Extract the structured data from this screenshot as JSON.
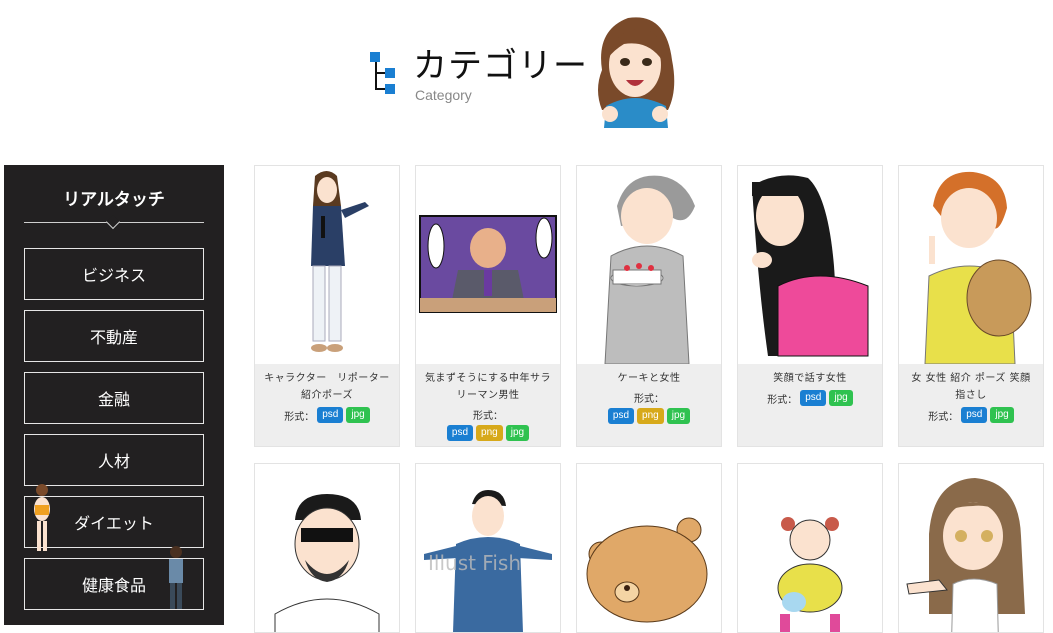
{
  "header": {
    "title": "カテゴリー",
    "subtitle": "Category"
  },
  "sidebar": {
    "heading": "リアルタッチ",
    "items": [
      {
        "label": "ビジネス"
      },
      {
        "label": "不動産"
      },
      {
        "label": "金融"
      },
      {
        "label": "人材"
      },
      {
        "label": "ダイエット"
      },
      {
        "label": "健康食品"
      }
    ]
  },
  "format_label": "形式：",
  "cards": [
    {
      "title": "キャラクター　リポーター　紹介ポーズ",
      "formats": [
        "psd",
        "jpg"
      ]
    },
    {
      "title": "気まずそうにする中年サラリーマン男性",
      "formats": [
        "psd",
        "png",
        "jpg"
      ]
    },
    {
      "title": "ケーキと女性",
      "formats": [
        "psd",
        "png",
        "jpg"
      ]
    },
    {
      "title": "笑顔で話す女性",
      "formats": [
        "psd",
        "jpg"
      ]
    },
    {
      "title": "女 女性 紹介 ポーズ 笑顔 指さし",
      "formats": [
        "psd",
        "jpg"
      ]
    }
  ],
  "colors": {
    "sidebar_bg": "#222021",
    "psd": "#1a7fd2",
    "png": "#d7a91a",
    "jpg": "#2fc250",
    "accent_blue": "#1a7fd2"
  }
}
